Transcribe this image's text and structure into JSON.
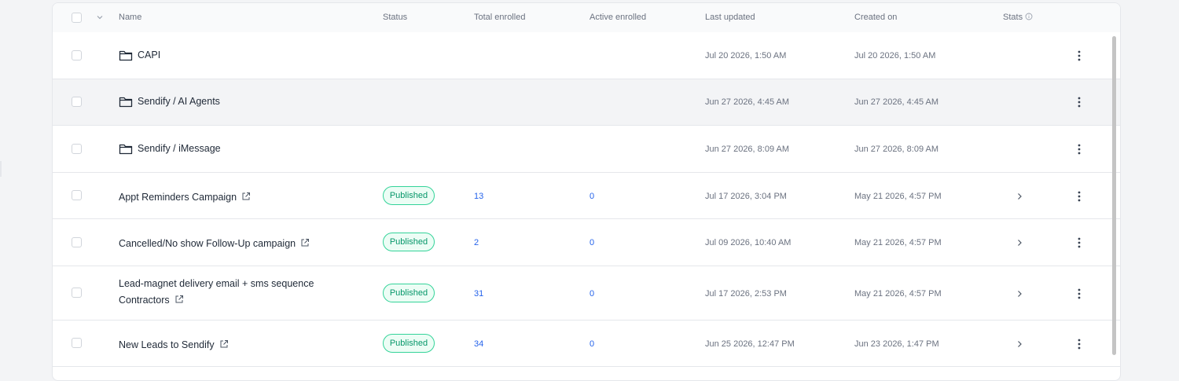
{
  "header": {
    "name": "Name",
    "status": "Status",
    "total_enrolled": "Total enrolled",
    "active_enrolled": "Active enrolled",
    "last_updated": "Last updated",
    "created_on": "Created on",
    "stats": "Stats"
  },
  "folders": [
    {
      "name": "CAPI",
      "last_updated": "Jul 20 2026, 1:50 AM",
      "created_on": "Jul 20 2026, 1:50 AM"
    },
    {
      "name": "Sendify / AI Agents",
      "last_updated": "Jun 27 2026, 4:45 AM",
      "created_on": "Jun 27 2026, 4:45 AM"
    },
    {
      "name": "Sendify / iMessage",
      "last_updated": "Jun 27 2026, 8:09 AM",
      "created_on": "Jun 27 2026, 8:09 AM"
    }
  ],
  "campaigns": [
    {
      "name": "Appt Reminders Campaign",
      "status": "Published",
      "total_enrolled": "13",
      "active_enrolled": "0",
      "last_updated": "Jul 17 2026, 3:04 PM",
      "created_on": "May 21 2026, 4:57 PM"
    },
    {
      "name": "Cancelled/No show Follow-Up campaign",
      "status": "Published",
      "total_enrolled": "2",
      "active_enrolled": "0",
      "last_updated": "Jul 09 2026, 10:40 AM",
      "created_on": "May 21 2026, 4:57 PM"
    },
    {
      "name_line1": "Lead-magnet delivery email + sms sequence",
      "name_line2": "Contractors",
      "status": "Published",
      "total_enrolled": "31",
      "active_enrolled": "0",
      "last_updated": "Jul 17 2026, 2:53 PM",
      "created_on": "May 21 2026, 4:57 PM"
    },
    {
      "name": "New Leads to Sendify",
      "status": "Published",
      "total_enrolled": "34",
      "active_enrolled": "0",
      "last_updated": "Jun 25 2026, 12:47 PM",
      "created_on": "Jun 23 2026, 1:47 PM"
    }
  ],
  "colors": {
    "published_text": "#059669",
    "published_border": "#34d399",
    "link_number": "#2563eb"
  }
}
